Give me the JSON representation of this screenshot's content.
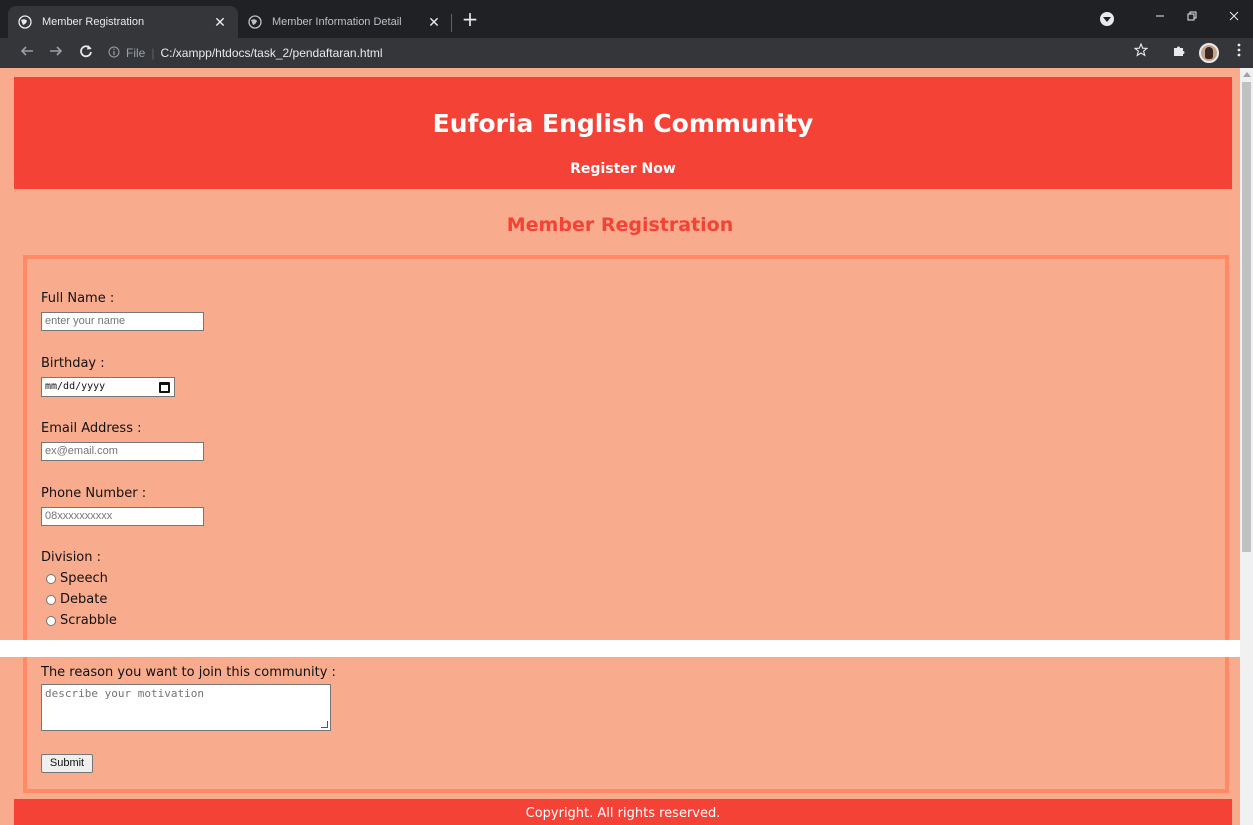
{
  "browser": {
    "tabs": [
      {
        "title": "Member Registration",
        "active": true
      },
      {
        "title": "Member Information Detail",
        "active": false
      }
    ],
    "close_glyph": "✕",
    "new_tab_glyph": "+",
    "address": {
      "scheme_label": "File",
      "url": "C:/xampp/htdocs/task_2/pendaftaran.html"
    },
    "icons": [
      "globe-icon",
      "back-arrow-icon",
      "forward-arrow-icon",
      "reload-icon",
      "info-icon",
      "star-icon",
      "extensions-puzzle-icon",
      "profile-avatar-icon",
      "kebab-menu-icon",
      "minimize-icon",
      "restore-icon",
      "close-window-icon",
      "tab-search-icon"
    ]
  },
  "page": {
    "header": {
      "title": "Euforia English Community",
      "subtitle": "Register Now"
    },
    "section_title": "Member Registration",
    "form": {
      "full_name": {
        "label": "Full Name :",
        "placeholder": "enter your name"
      },
      "birthday": {
        "label": "Birthday :",
        "placeholder": "mm/dd/yyyy"
      },
      "email": {
        "label": "Email Address :",
        "placeholder": "ex@email.com"
      },
      "phone": {
        "label": "Phone Number :",
        "placeholder": "08xxxxxxxxxx"
      },
      "division": {
        "label": "Division :",
        "options": [
          "Speech",
          "Debate",
          "Scrabble"
        ]
      },
      "reason": {
        "label": "The reason you want to join this community :",
        "placeholder": "describe your motivation"
      },
      "submit_label": "Submit"
    },
    "footer": "Copyright. All rights reserved.",
    "colors": {
      "header_bg": "#f44336",
      "page_bg": "#f9ac8d",
      "form_border": "#ff8a65",
      "section_title": "#f44336"
    }
  }
}
